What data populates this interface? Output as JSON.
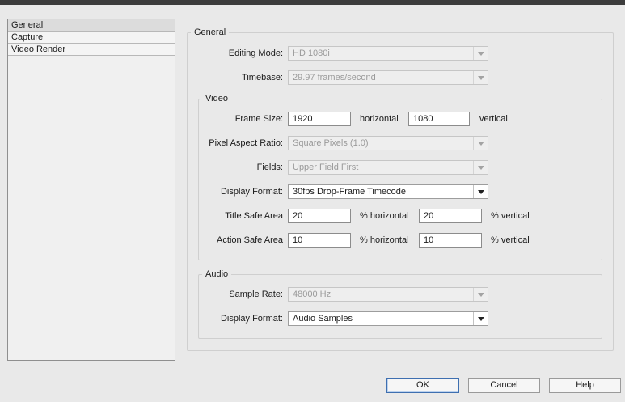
{
  "sidebar": {
    "items": [
      {
        "label": "General"
      },
      {
        "label": "Capture"
      },
      {
        "label": "Video Render"
      }
    ]
  },
  "general": {
    "legend": "General",
    "editing_mode": {
      "label": "Editing Mode:",
      "value": "HD 1080i"
    },
    "timebase": {
      "label": "Timebase:",
      "value": "29.97 frames/second"
    }
  },
  "video": {
    "legend": "Video",
    "frame_size": {
      "label": "Frame Size:",
      "horizontal_value": "1920",
      "horizontal_label": "horizontal",
      "vertical_value": "1080",
      "vertical_label": "vertical"
    },
    "pixel_aspect_ratio": {
      "label": "Pixel Aspect Ratio:",
      "value": "Square Pixels (1.0)"
    },
    "fields": {
      "label": "Fields:",
      "value": "Upper Field First"
    },
    "display_format": {
      "label": "Display Format:",
      "value": "30fps Drop-Frame Timecode"
    },
    "title_safe_area": {
      "label": "Title Safe Area",
      "horizontal_value": "20",
      "horizontal_label": "% horizontal",
      "vertical_value": "20",
      "vertical_label": "% vertical"
    },
    "action_safe_area": {
      "label": "Action Safe Area",
      "horizontal_value": "10",
      "horizontal_label": "% horizontal",
      "vertical_value": "10",
      "vertical_label": "% vertical"
    }
  },
  "audio": {
    "legend": "Audio",
    "sample_rate": {
      "label": "Sample Rate:",
      "value": "48000 Hz"
    },
    "display_format": {
      "label": "Display Format:",
      "value": "Audio Samples"
    }
  },
  "buttons": {
    "ok": "OK",
    "cancel": "Cancel",
    "help": "Help"
  }
}
